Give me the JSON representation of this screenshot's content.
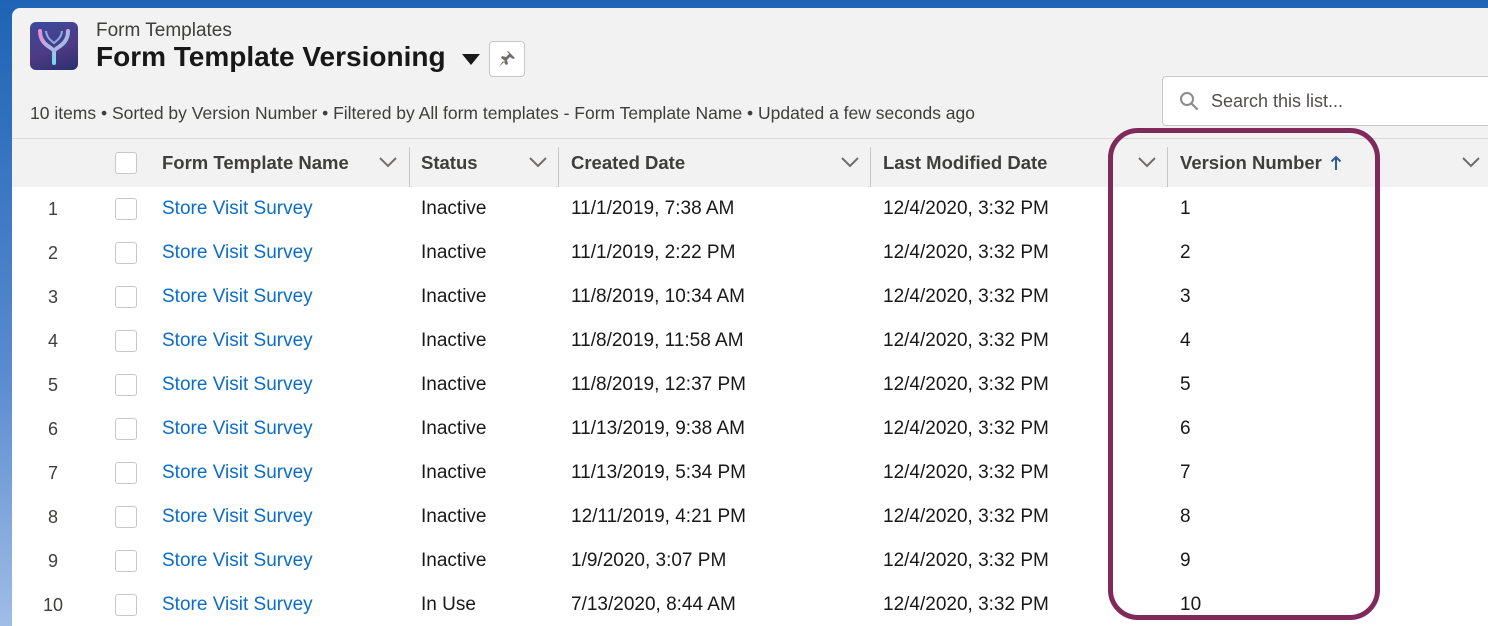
{
  "header": {
    "object_label": "Form Templates",
    "list_title": "Form Template Versioning",
    "status_line": "10 items • Sorted by Version Number • Filtered by All form templates - Form Template Name • Updated a few seconds ago"
  },
  "search": {
    "placeholder": "Search this list..."
  },
  "columns": [
    {
      "label": "Form Template Name"
    },
    {
      "label": "Status"
    },
    {
      "label": "Created Date"
    },
    {
      "label": "Last Modified Date"
    },
    {
      "label": "Version Number",
      "sort": "ascending"
    }
  ],
  "rows": [
    {
      "num": "1",
      "name": "Store Visit Survey",
      "status": "Inactive",
      "created": "11/1/2019, 7:38 AM",
      "modified": "12/4/2020, 3:32 PM",
      "version": "1"
    },
    {
      "num": "2",
      "name": "Store Visit Survey",
      "status": "Inactive",
      "created": "11/1/2019, 2:22 PM",
      "modified": "12/4/2020, 3:32 PM",
      "version": "2"
    },
    {
      "num": "3",
      "name": "Store Visit Survey",
      "status": "Inactive",
      "created": "11/8/2019, 10:34 AM",
      "modified": "12/4/2020, 3:32 PM",
      "version": "3"
    },
    {
      "num": "4",
      "name": "Store Visit Survey",
      "status": "Inactive",
      "created": "11/8/2019, 11:58 AM",
      "modified": "12/4/2020, 3:32 PM",
      "version": "4"
    },
    {
      "num": "5",
      "name": "Store Visit Survey",
      "status": "Inactive",
      "created": "11/8/2019, 12:37 PM",
      "modified": "12/4/2020, 3:32 PM",
      "version": "5"
    },
    {
      "num": "6",
      "name": "Store Visit Survey",
      "status": "Inactive",
      "created": "11/13/2019, 9:38 AM",
      "modified": "12/4/2020, 3:32 PM",
      "version": "6"
    },
    {
      "num": "7",
      "name": "Store Visit Survey",
      "status": "Inactive",
      "created": "11/13/2019, 5:34 PM",
      "modified": "12/4/2020, 3:32 PM",
      "version": "7"
    },
    {
      "num": "8",
      "name": "Store Visit Survey",
      "status": "Inactive",
      "created": "12/11/2019, 4:21 PM",
      "modified": "12/4/2020, 3:32 PM",
      "version": "8"
    },
    {
      "num": "9",
      "name": "Store Visit Survey",
      "status": "Inactive",
      "created": "1/9/2020, 3:07 PM",
      "modified": "12/4/2020, 3:32 PM",
      "version": "9"
    },
    {
      "num": "10",
      "name": "Store Visit Survey",
      "status": "In Use",
      "created": "7/13/2020, 8:44 AM",
      "modified": "12/4/2020, 3:32 PM",
      "version": "10"
    }
  ],
  "colors": {
    "link": "#0b6dc7",
    "highlight_border": "#7f2a5a",
    "sort_arrow": "#2f5b9a"
  }
}
